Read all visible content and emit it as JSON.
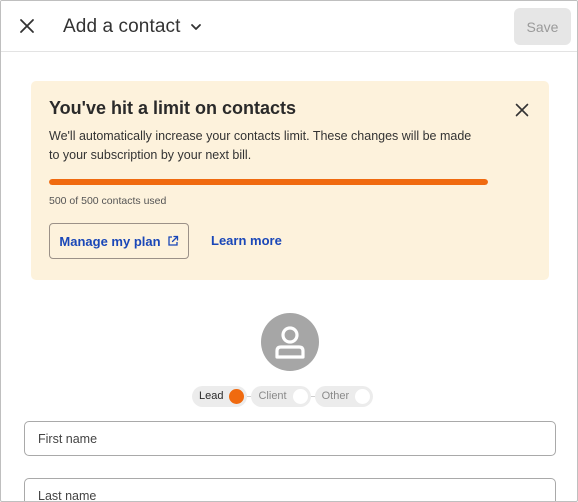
{
  "header": {
    "title": "Add a contact",
    "save_label": "Save",
    "close_icon": "close-icon",
    "dropdown_icon": "chevron-down-icon"
  },
  "banner": {
    "title": "You've hit a limit on contacts",
    "body": "We'll automatically increase your contacts limit. These changes will be made to your subscription by your next bill.",
    "usage_text": "500 of 500 contacts used",
    "usage_fraction": 1.0,
    "manage_label": "Manage my plan",
    "manage_icon": "external-link-icon",
    "learn_more_label": "Learn more",
    "close_icon": "close-icon"
  },
  "contact_type": {
    "options": [
      {
        "label": "Lead",
        "selected": true
      },
      {
        "label": "Client",
        "selected": false
      },
      {
        "label": "Other",
        "selected": false
      }
    ]
  },
  "form": {
    "first_name_placeholder": "First name",
    "last_name_placeholder": "Last name"
  },
  "colors": {
    "accent": "#f06a0f",
    "banner_bg": "#fdf2dc",
    "link": "#1a47b8"
  }
}
